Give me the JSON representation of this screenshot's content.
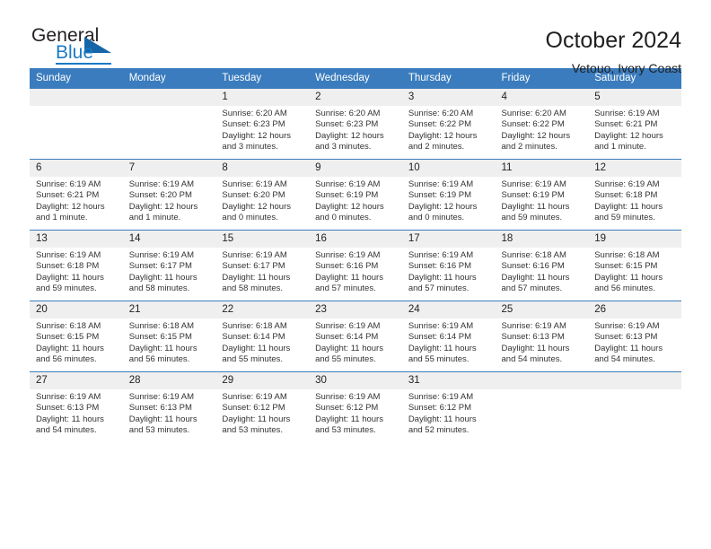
{
  "brand": {
    "name_top": "General",
    "name_bottom": "Blue"
  },
  "header": {
    "title": "October 2024",
    "subtitle": "Vetouo, Ivory Coast"
  },
  "colors": {
    "header_blue": "#3a7cbe",
    "daynum_band": "#efefef",
    "brand_blue": "#1a7ac4",
    "text": "#222222"
  },
  "weekdays": [
    "Sunday",
    "Monday",
    "Tuesday",
    "Wednesday",
    "Thursday",
    "Friday",
    "Saturday"
  ],
  "labels": {
    "sunrise_prefix": "Sunrise:",
    "sunset_prefix": "Sunset:",
    "daylight_prefix": "Daylight:"
  },
  "weeks": [
    [
      {
        "day": "",
        "sunrise": "",
        "sunset": "",
        "daylight": "",
        "blank": true
      },
      {
        "day": "",
        "sunrise": "",
        "sunset": "",
        "daylight": "",
        "blank": true
      },
      {
        "day": "1",
        "sunrise": "Sunrise: 6:20 AM",
        "sunset": "Sunset: 6:23 PM",
        "daylight": "Daylight: 12 hours and 3 minutes."
      },
      {
        "day": "2",
        "sunrise": "Sunrise: 6:20 AM",
        "sunset": "Sunset: 6:23 PM",
        "daylight": "Daylight: 12 hours and 3 minutes."
      },
      {
        "day": "3",
        "sunrise": "Sunrise: 6:20 AM",
        "sunset": "Sunset: 6:22 PM",
        "daylight": "Daylight: 12 hours and 2 minutes."
      },
      {
        "day": "4",
        "sunrise": "Sunrise: 6:20 AM",
        "sunset": "Sunset: 6:22 PM",
        "daylight": "Daylight: 12 hours and 2 minutes."
      },
      {
        "day": "5",
        "sunrise": "Sunrise: 6:19 AM",
        "sunset": "Sunset: 6:21 PM",
        "daylight": "Daylight: 12 hours and 1 minute."
      }
    ],
    [
      {
        "day": "6",
        "sunrise": "Sunrise: 6:19 AM",
        "sunset": "Sunset: 6:21 PM",
        "daylight": "Daylight: 12 hours and 1 minute."
      },
      {
        "day": "7",
        "sunrise": "Sunrise: 6:19 AM",
        "sunset": "Sunset: 6:20 PM",
        "daylight": "Daylight: 12 hours and 1 minute."
      },
      {
        "day": "8",
        "sunrise": "Sunrise: 6:19 AM",
        "sunset": "Sunset: 6:20 PM",
        "daylight": "Daylight: 12 hours and 0 minutes."
      },
      {
        "day": "9",
        "sunrise": "Sunrise: 6:19 AM",
        "sunset": "Sunset: 6:19 PM",
        "daylight": "Daylight: 12 hours and 0 minutes."
      },
      {
        "day": "10",
        "sunrise": "Sunrise: 6:19 AM",
        "sunset": "Sunset: 6:19 PM",
        "daylight": "Daylight: 12 hours and 0 minutes."
      },
      {
        "day": "11",
        "sunrise": "Sunrise: 6:19 AM",
        "sunset": "Sunset: 6:19 PM",
        "daylight": "Daylight: 11 hours and 59 minutes."
      },
      {
        "day": "12",
        "sunrise": "Sunrise: 6:19 AM",
        "sunset": "Sunset: 6:18 PM",
        "daylight": "Daylight: 11 hours and 59 minutes."
      }
    ],
    [
      {
        "day": "13",
        "sunrise": "Sunrise: 6:19 AM",
        "sunset": "Sunset: 6:18 PM",
        "daylight": "Daylight: 11 hours and 59 minutes."
      },
      {
        "day": "14",
        "sunrise": "Sunrise: 6:19 AM",
        "sunset": "Sunset: 6:17 PM",
        "daylight": "Daylight: 11 hours and 58 minutes."
      },
      {
        "day": "15",
        "sunrise": "Sunrise: 6:19 AM",
        "sunset": "Sunset: 6:17 PM",
        "daylight": "Daylight: 11 hours and 58 minutes."
      },
      {
        "day": "16",
        "sunrise": "Sunrise: 6:19 AM",
        "sunset": "Sunset: 6:16 PM",
        "daylight": "Daylight: 11 hours and 57 minutes."
      },
      {
        "day": "17",
        "sunrise": "Sunrise: 6:19 AM",
        "sunset": "Sunset: 6:16 PM",
        "daylight": "Daylight: 11 hours and 57 minutes."
      },
      {
        "day": "18",
        "sunrise": "Sunrise: 6:18 AM",
        "sunset": "Sunset: 6:16 PM",
        "daylight": "Daylight: 11 hours and 57 minutes."
      },
      {
        "day": "19",
        "sunrise": "Sunrise: 6:18 AM",
        "sunset": "Sunset: 6:15 PM",
        "daylight": "Daylight: 11 hours and 56 minutes."
      }
    ],
    [
      {
        "day": "20",
        "sunrise": "Sunrise: 6:18 AM",
        "sunset": "Sunset: 6:15 PM",
        "daylight": "Daylight: 11 hours and 56 minutes."
      },
      {
        "day": "21",
        "sunrise": "Sunrise: 6:18 AM",
        "sunset": "Sunset: 6:15 PM",
        "daylight": "Daylight: 11 hours and 56 minutes."
      },
      {
        "day": "22",
        "sunrise": "Sunrise: 6:18 AM",
        "sunset": "Sunset: 6:14 PM",
        "daylight": "Daylight: 11 hours and 55 minutes."
      },
      {
        "day": "23",
        "sunrise": "Sunrise: 6:19 AM",
        "sunset": "Sunset: 6:14 PM",
        "daylight": "Daylight: 11 hours and 55 minutes."
      },
      {
        "day": "24",
        "sunrise": "Sunrise: 6:19 AM",
        "sunset": "Sunset: 6:14 PM",
        "daylight": "Daylight: 11 hours and 55 minutes."
      },
      {
        "day": "25",
        "sunrise": "Sunrise: 6:19 AM",
        "sunset": "Sunset: 6:13 PM",
        "daylight": "Daylight: 11 hours and 54 minutes."
      },
      {
        "day": "26",
        "sunrise": "Sunrise: 6:19 AM",
        "sunset": "Sunset: 6:13 PM",
        "daylight": "Daylight: 11 hours and 54 minutes."
      }
    ],
    [
      {
        "day": "27",
        "sunrise": "Sunrise: 6:19 AM",
        "sunset": "Sunset: 6:13 PM",
        "daylight": "Daylight: 11 hours and 54 minutes."
      },
      {
        "day": "28",
        "sunrise": "Sunrise: 6:19 AM",
        "sunset": "Sunset: 6:13 PM",
        "daylight": "Daylight: 11 hours and 53 minutes."
      },
      {
        "day": "29",
        "sunrise": "Sunrise: 6:19 AM",
        "sunset": "Sunset: 6:12 PM",
        "daylight": "Daylight: 11 hours and 53 minutes."
      },
      {
        "day": "30",
        "sunrise": "Sunrise: 6:19 AM",
        "sunset": "Sunset: 6:12 PM",
        "daylight": "Daylight: 11 hours and 53 minutes."
      },
      {
        "day": "31",
        "sunrise": "Sunrise: 6:19 AM",
        "sunset": "Sunset: 6:12 PM",
        "daylight": "Daylight: 11 hours and 52 minutes."
      },
      {
        "day": "",
        "sunrise": "",
        "sunset": "",
        "daylight": "",
        "blank": true
      },
      {
        "day": "",
        "sunrise": "",
        "sunset": "",
        "daylight": "",
        "blank": true
      }
    ]
  ]
}
